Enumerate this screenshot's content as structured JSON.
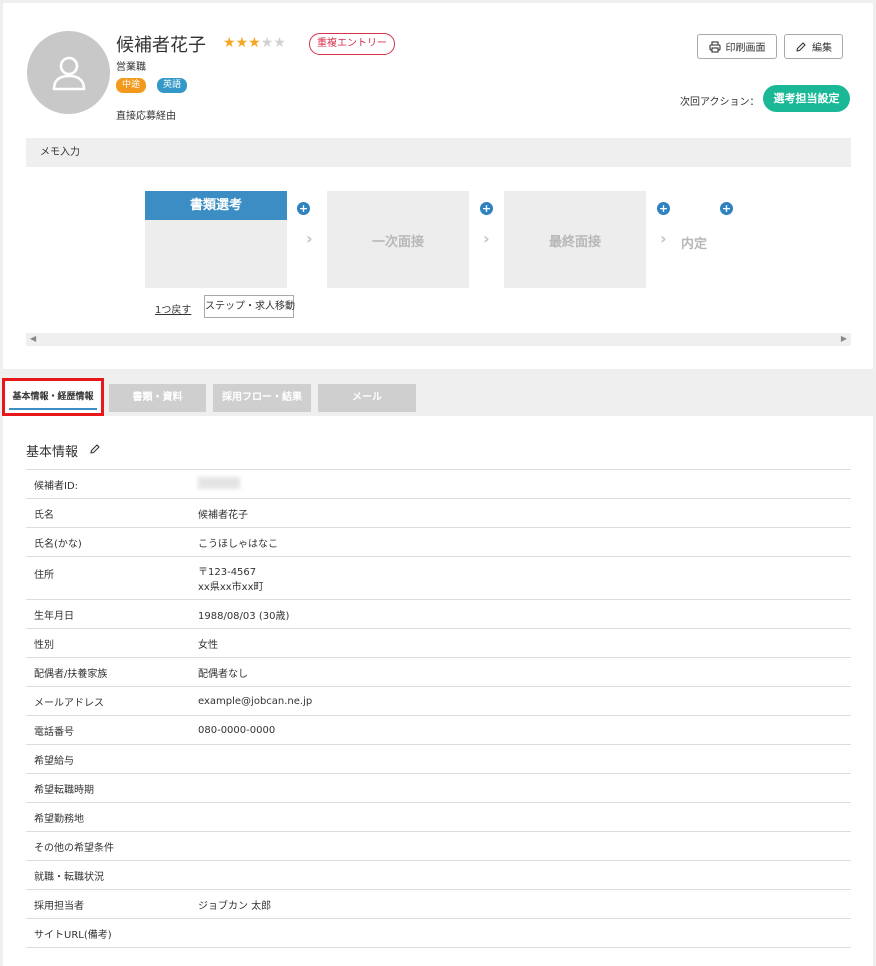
{
  "candidate": {
    "name": "候補者花子",
    "rating": 3,
    "rating_max": 5,
    "duplicate_badge": "重複エントリー",
    "job_title": "営業職",
    "tags": [
      {
        "label": "中途",
        "color": "#f39a1e"
      },
      {
        "label": "英語",
        "color": "#3498c8"
      }
    ],
    "route": "直接応募経由"
  },
  "actions": {
    "print_label": "印刷画面",
    "edit_label": "編集",
    "next_action_label": "次回アクション：",
    "assign_label": "選考担当設定"
  },
  "memo": {
    "label": "メモ入力"
  },
  "flow": {
    "steps": [
      {
        "label": "書類選考",
        "active": true
      },
      {
        "label": "一次面接",
        "active": false
      },
      {
        "label": "最終面接",
        "active": false
      },
      {
        "label": "内定",
        "active": false
      }
    ],
    "back_label": "1つ戻す",
    "move_label": "ステップ・求人移動"
  },
  "tabs": [
    {
      "label": "基本情報・経歴情報",
      "active": true
    },
    {
      "label": "書類・資料",
      "active": false
    },
    {
      "label": "採用フロー・結果",
      "active": false
    },
    {
      "label": "メール",
      "active": false
    }
  ],
  "basic_info": {
    "title": "基本情報",
    "rows": [
      {
        "key": "候補者ID:",
        "value": ""
      },
      {
        "key": "氏名",
        "value": "候補者花子"
      },
      {
        "key": "氏名(かな)",
        "value": "こうほしゃはなこ"
      },
      {
        "key": "住所",
        "value": "〒123-4567",
        "value2": "xx県xx市xx町"
      },
      {
        "key": "生年月日",
        "value": "1988/08/03 (30歳)"
      },
      {
        "key": "性別",
        "value": "女性"
      },
      {
        "key": "配偶者/扶養家族",
        "value": "配偶者なし"
      },
      {
        "key": "メールアドレス",
        "value": "example@jobcan.ne.jp"
      },
      {
        "key": "電話番号",
        "value": "080-0000-0000"
      },
      {
        "key": "希望給与",
        "value": ""
      },
      {
        "key": "希望転職時期",
        "value": ""
      },
      {
        "key": "希望勤務地",
        "value": ""
      },
      {
        "key": "その他の希望条件",
        "value": ""
      },
      {
        "key": "就職・転職状況",
        "value": ""
      },
      {
        "key": "採用担当者",
        "value": "ジョブカン 太郎"
      },
      {
        "key": "サイトURL(備考)",
        "value": ""
      }
    ]
  },
  "colors": {
    "accent_green": "#1bb897",
    "accent_blue": "#3b8dc3",
    "highlight_red": "#e8171b"
  }
}
